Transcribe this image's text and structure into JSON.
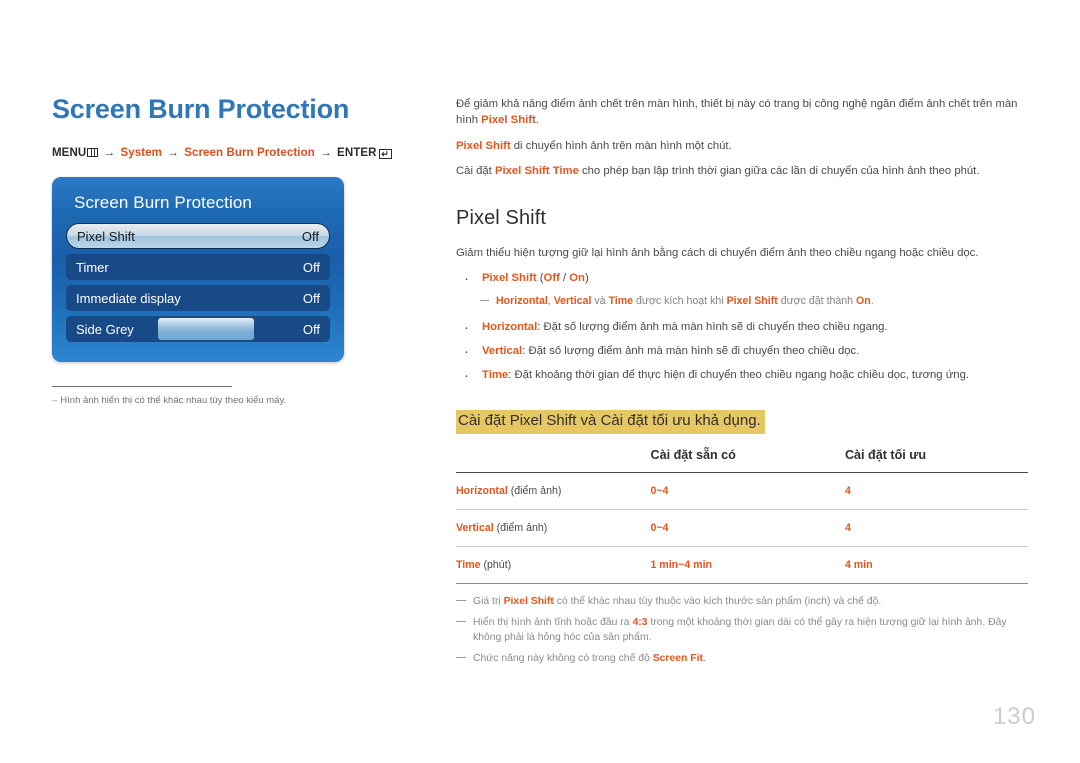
{
  "page": {
    "title": "Screen Burn Protection",
    "number": "130"
  },
  "breadcrumb": {
    "menu_label": "MENU",
    "arrow": "→",
    "system": "System",
    "screen_burn_protection": "Screen Burn Protection",
    "enter_label": "ENTER",
    "enter_glyph": "↵"
  },
  "osd": {
    "title": "Screen Burn Protection",
    "rows": [
      {
        "label": "Pixel Shift",
        "value": "Off",
        "selected": true,
        "slider": false
      },
      {
        "label": "Timer",
        "value": "Off",
        "selected": false,
        "slider": false
      },
      {
        "label": "Immediate display",
        "value": "Off",
        "selected": false,
        "slider": false
      },
      {
        "label": "Side Grey",
        "value": "Off",
        "selected": false,
        "slider": true
      }
    ]
  },
  "left_note": {
    "dash": "–",
    "text": "Hình ảnh hiển thị có thể khác nhau tùy theo kiểu máy."
  },
  "intro": {
    "p1_a": "Để giảm khả năng điểm ảnh chết trên màn hình, thiết bị này có trang bị công nghệ ngăn điểm ảnh chết trên màn hình ",
    "p1_accent": "Pixel Shift",
    "p1_b": ".",
    "p2_accent": "Pixel Shift",
    "p2_b": " di chuyển hình ảnh trên màn hình một chút.",
    "p3_a": "Cài đặt ",
    "p3_accent": "Pixel Shift Time",
    "p3_b": " cho phép bạn lập trình thời gian giữa các lần di chuyển của hình ảnh theo phút."
  },
  "section": {
    "heading": "Pixel Shift",
    "lead": "Giảm thiểu hiện tượng giữ lại hình ảnh bằng cách di chuyển điểm ảnh theo chiều ngang hoặc chiều dọc.",
    "bullet1": {
      "name": "Pixel Shift",
      "options_open": " (",
      "opt_off": "Off",
      "opt_sep": " / ",
      "opt_on": "On",
      "options_close": ")"
    },
    "subnote1": {
      "a": "Horizontal",
      "sep1": ", ",
      "b": "Vertical",
      "sep2": " và ",
      "c": "Time",
      "mid": " được kích hoạt khi ",
      "d": "Pixel Shift",
      "mid2": " được đặt thành ",
      "e": "On",
      "end": "."
    },
    "bullet2": {
      "name": "Horizontal",
      "text": ": Đặt số lượng điểm ảnh mà màn hình sẽ di chuyển theo chiều ngang."
    },
    "bullet3": {
      "name": "Vertical",
      "text": ": Đặt số lượng điểm ảnh mà màn hình sẽ đi chuyển theo chiều dọc."
    },
    "bullet4": {
      "name": "Time",
      "text": ": Đặt khoảng thời gian để thực hiện đi chuyển theo chiều ngang hoặc chiều dọc, tương ứng."
    },
    "highlight": "Cài đặt Pixel Shift và Cài đặt tối ưu khả dụng."
  },
  "table": {
    "headers": [
      "",
      "Cài đặt sẵn có",
      "Cài đặt tối ưu"
    ],
    "rows": [
      {
        "name": "Horizontal",
        "unit": " (điểm ảnh)",
        "available": "0~4",
        "optimum": "4"
      },
      {
        "name": "Vertical",
        "unit": " (điểm ảnh)",
        "available": "0~4",
        "optimum": "4"
      },
      {
        "name": "Time",
        "unit": " (phút)",
        "available": "1 min~4 min",
        "optimum": "4 min"
      }
    ]
  },
  "footnotes": [
    {
      "a": "Giá trị ",
      "accent": "Pixel Shift",
      "b": " có thể khác nhau tùy thuộc vào kích thước sản phẩm (inch) và chế độ."
    },
    {
      "a": "Hiển thị hình ảnh tĩnh hoặc đầu ra ",
      "accent": "4:3",
      "b": " trong một khoảng thời gian dài có thể gây ra hiện tượng giữ lại hình ảnh. Đây không phải là hỏng hóc của sản phẩm."
    },
    {
      "a": "Chức năng này không có trong chế độ ",
      "accent": "Screen Fit",
      "b": "."
    }
  ],
  "colors": {
    "title_blue": "#2f77b8",
    "accent_orange": "#e0571f",
    "highlight_gold": "#e7c664",
    "osd_blue": "#1f6ab4",
    "page_number_gray": "#c9cbd6"
  }
}
